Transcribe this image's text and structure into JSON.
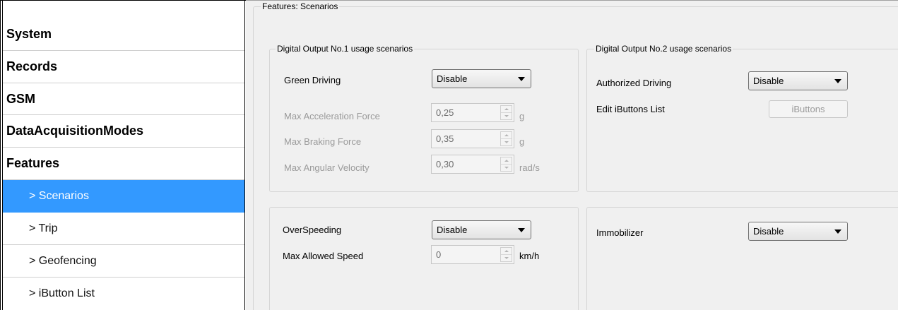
{
  "sidebar": {
    "items": [
      {
        "label": "System"
      },
      {
        "label": "Records"
      },
      {
        "label": "GSM"
      },
      {
        "label": "DataAcquisitionModes"
      },
      {
        "label": "Features"
      },
      {
        "label": "> Scenarios"
      },
      {
        "label": "> Trip"
      },
      {
        "label": "> Geofencing"
      },
      {
        "label": "> iButton List"
      }
    ]
  },
  "main": {
    "group_title": "Features: Scenarios",
    "do1": {
      "title": "Digital Output No.1 usage scenarios",
      "green_driving_label": "Green Driving",
      "green_driving_value": "Disable",
      "max_accel_label": "Max Acceleration Force",
      "max_accel_value": "0,25",
      "max_accel_unit": "g",
      "max_braking_label": "Max Braking Force",
      "max_braking_value": "0,35",
      "max_braking_unit": "g",
      "max_angular_label": "Max Angular Velocity",
      "max_angular_value": "0,30",
      "max_angular_unit": "rad/s"
    },
    "do2": {
      "title": "Digital Output No.2 usage scenarios",
      "authorized_label": "Authorized Driving",
      "authorized_value": "Disable",
      "ibuttons_label": "Edit iButtons List",
      "ibuttons_button": "iButtons"
    },
    "overspeed": {
      "label": "OverSpeeding",
      "value": "Disable",
      "max_speed_label": "Max Allowed Speed",
      "max_speed_value": "0",
      "max_speed_unit": "km/h"
    },
    "immobilizer": {
      "label": "Immobilizer",
      "value": "Disable"
    }
  },
  "colors": {
    "selection": "#3399ff",
    "panel_background": "#f0f0f0",
    "disabled_text": "#9a9a9a"
  }
}
